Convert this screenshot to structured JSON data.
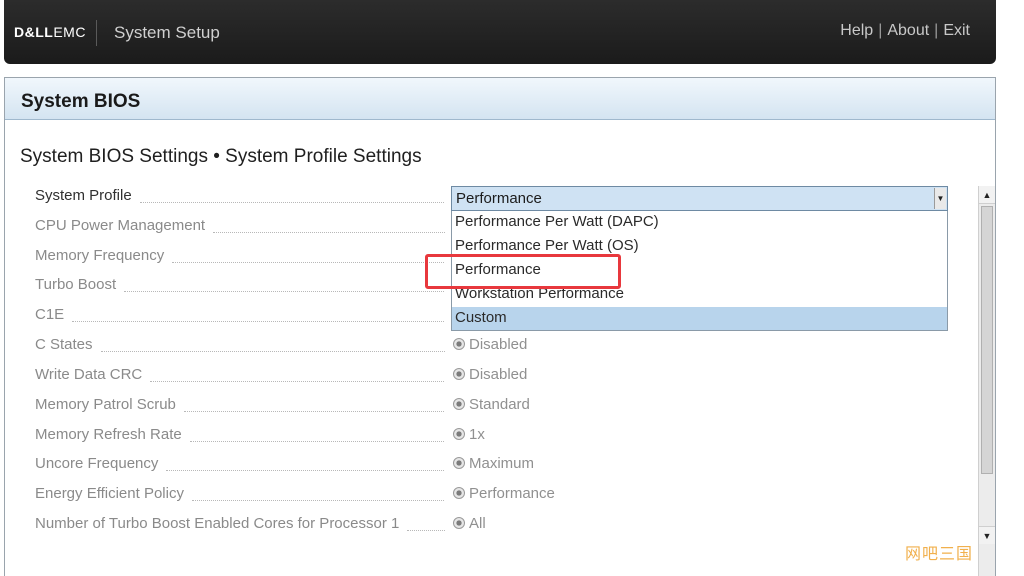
{
  "header": {
    "brand_dell": "D&LL",
    "brand_emc": "EMC",
    "app_title": "System Setup",
    "links": [
      "Help",
      "About",
      "Exit"
    ]
  },
  "panel": {
    "title": "System BIOS",
    "section_title": "System BIOS Settings • System Profile Settings"
  },
  "settings": [
    {
      "label": "System Profile",
      "active": true,
      "value": "Performance"
    },
    {
      "label": "CPU Power Management"
    },
    {
      "label": "Memory Frequency"
    },
    {
      "label": "Turbo Boost"
    },
    {
      "label": "C1E"
    },
    {
      "label": "C States",
      "value": "Disabled"
    },
    {
      "label": "Write Data CRC",
      "value": "Disabled"
    },
    {
      "label": "Memory Patrol Scrub",
      "value": "Standard"
    },
    {
      "label": "Memory Refresh Rate",
      "value": "1x"
    },
    {
      "label": "Uncore Frequency",
      "value": "Maximum"
    },
    {
      "label": "Energy Efficient Policy",
      "value": "Performance"
    },
    {
      "label": "Number of Turbo Boost Enabled Cores for Processor 1",
      "value": "All"
    }
  ],
  "dropdown": {
    "current": "Performance",
    "options": [
      "Performance Per Watt (DAPC)",
      "Performance Per Watt (OS)",
      "Performance",
      "Workstation Performance",
      "Custom"
    ],
    "highlighted_option": "Custom"
  },
  "colors": {
    "header_bg": "#1b1b1b",
    "panel_header_bg": "#d4e4f1",
    "selection": "#b8d4ec",
    "callout": "#e8383d"
  },
  "watermark": "网吧三国"
}
